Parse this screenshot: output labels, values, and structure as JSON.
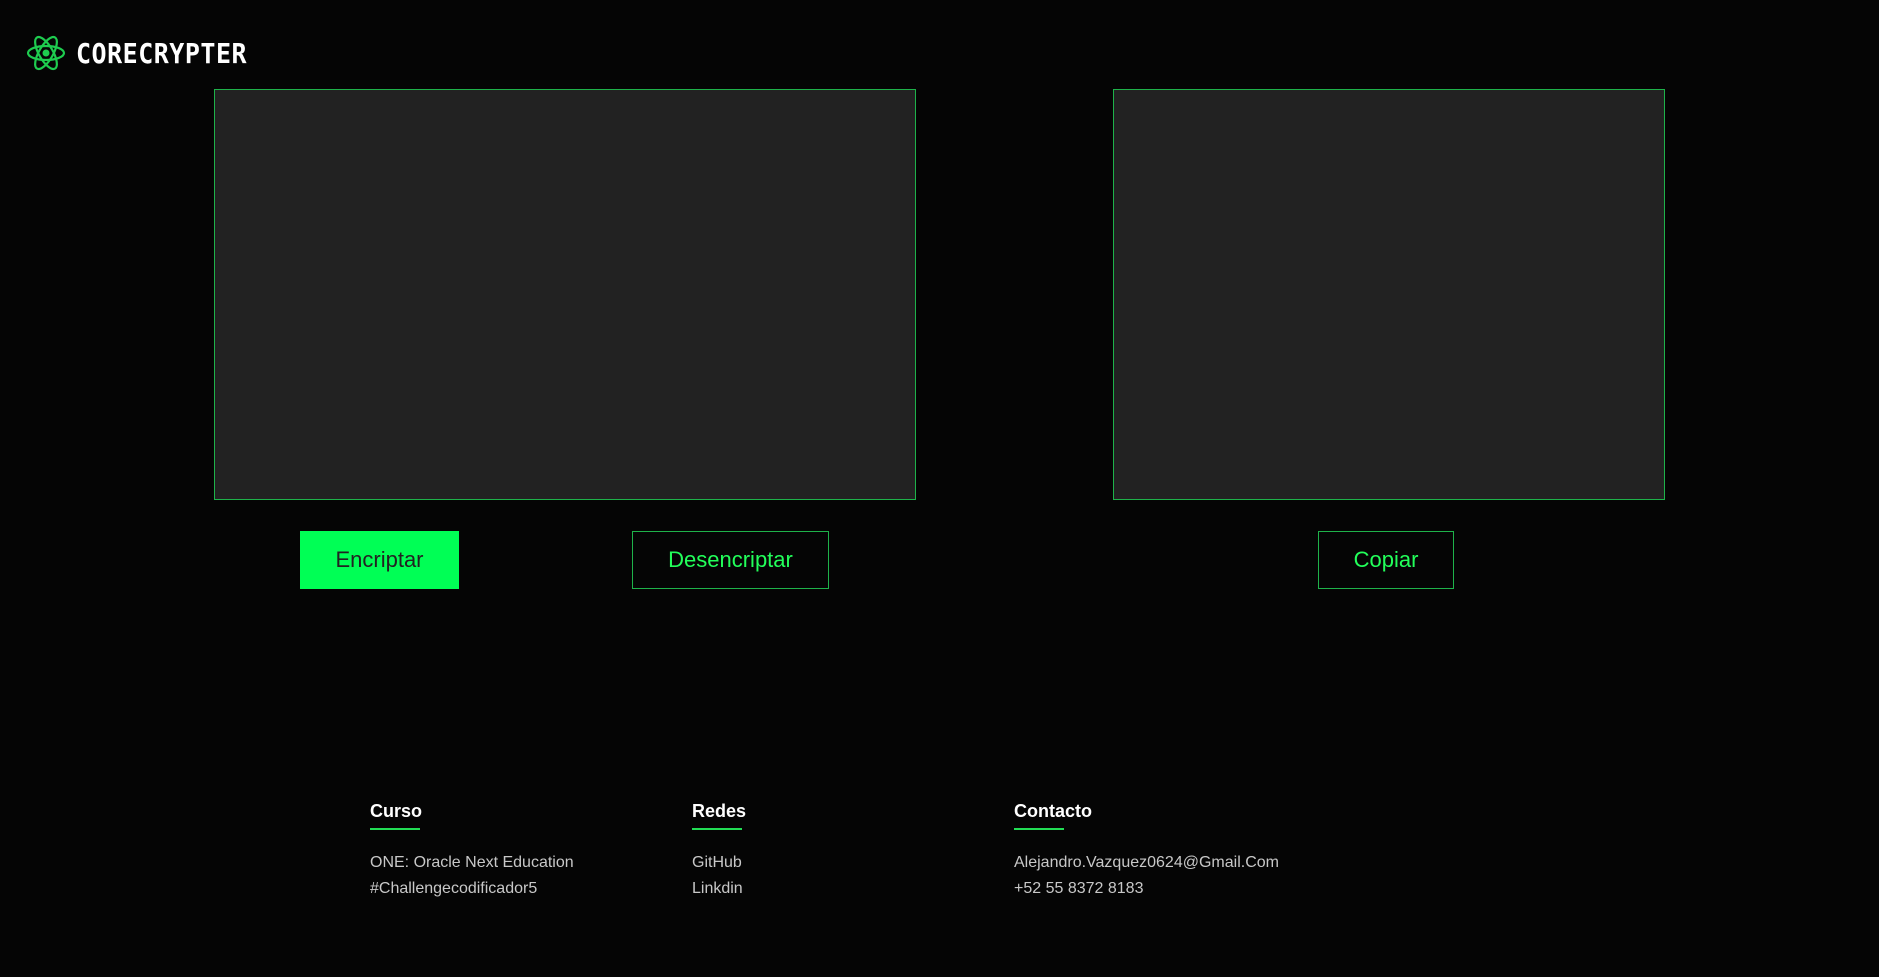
{
  "header": {
    "brand": "CORECRYPTER",
    "logo_icon": "atom-icon",
    "accent_color": "#00ff55"
  },
  "editor": {
    "input_value": "",
    "output_value": ""
  },
  "buttons": {
    "encrypt_label": "Encriptar",
    "decrypt_label": "Desencriptar",
    "copy_label": "Copiar"
  },
  "footer": {
    "curso": {
      "title": "Curso",
      "items": [
        "ONE: Oracle Next Education",
        "#Challengecodificador5"
      ]
    },
    "redes": {
      "title": "Redes",
      "items": [
        "GitHub",
        "Linkdin"
      ]
    },
    "contacto": {
      "title": "Contacto",
      "items": [
        "Alejandro.Vazquez0624@Gmail.Com",
        "+52 55 8372 8183"
      ]
    }
  }
}
